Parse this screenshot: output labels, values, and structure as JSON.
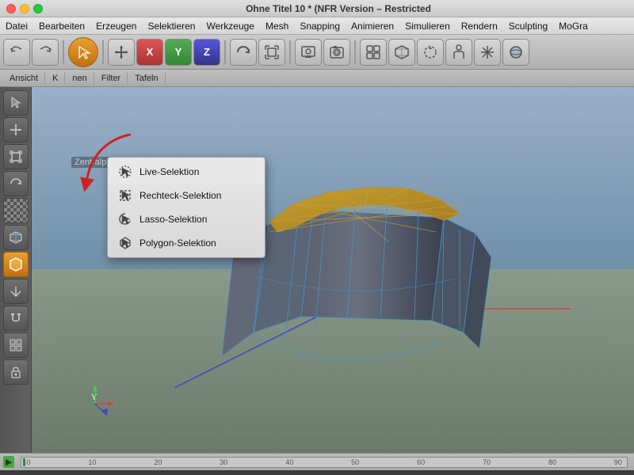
{
  "titlebar": {
    "title": "Ohne Titel 10 * (NFR Version – Restricted",
    "sculpting": "Sculpting",
    "restricted": "Restricted"
  },
  "menubar": {
    "items": [
      "Datei",
      "Bearbeiten",
      "Erzeugen",
      "Selektieren",
      "Werkzeuge",
      "Mesh",
      "Snapping",
      "Animieren",
      "Simulieren",
      "Rendern",
      "Sculpting",
      "MoGra"
    ]
  },
  "toolbar2": {
    "tabs": [
      "Ansicht",
      "K",
      "nen",
      "Filter",
      "Tafeln"
    ]
  },
  "viewport": {
    "label": "Zentralperspek"
  },
  "dropdown": {
    "items": [
      {
        "id": "live",
        "label": "Live-Selektion",
        "active": true
      },
      {
        "id": "rect",
        "label": "Rechteck-Selektion",
        "active": false
      },
      {
        "id": "lasso",
        "label": "Lasso-Selektion",
        "active": false
      },
      {
        "id": "polygon",
        "label": "Polygon-Selektion",
        "active": false
      }
    ]
  },
  "timeline": {
    "markers": [
      "0",
      "10",
      "20",
      "30",
      "40",
      "50",
      "60",
      "70",
      "80",
      "90"
    ]
  }
}
